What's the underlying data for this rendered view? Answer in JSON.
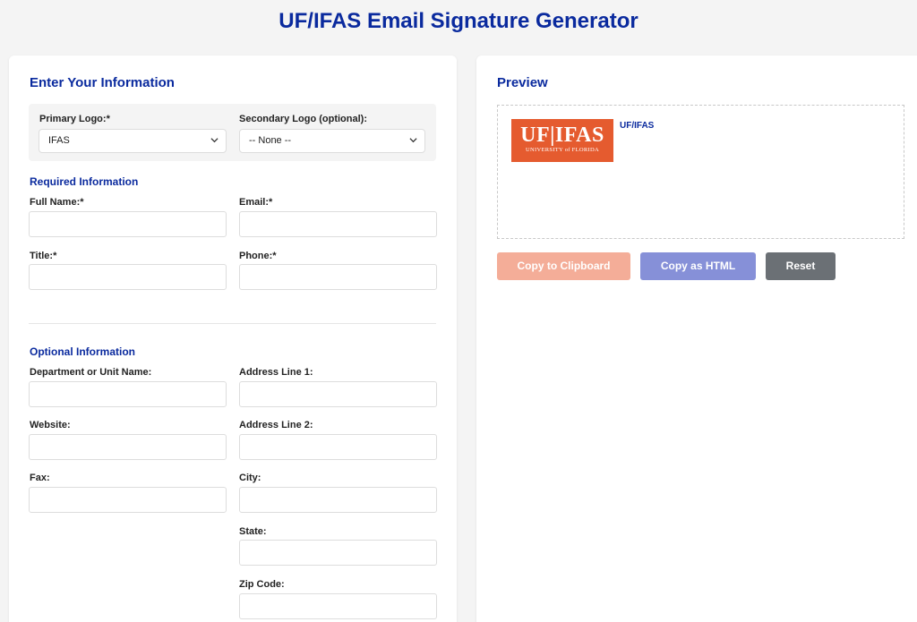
{
  "page": {
    "title": "UF/IFAS Email Signature Generator"
  },
  "form": {
    "heading": "Enter Your Information",
    "primary_logo": {
      "label": "Primary Logo:*",
      "value": "IFAS"
    },
    "secondary_logo": {
      "label": "Secondary Logo (optional):",
      "value": "-- None --"
    },
    "required_heading": "Required Information",
    "required_fields": {
      "full_name": "Full Name:*",
      "email": "Email:*",
      "title": "Title:*",
      "phone": "Phone:*"
    },
    "optional_heading": "Optional Information",
    "optional_fields": {
      "department": "Department or Unit Name:",
      "address1": "Address Line 1:",
      "website": "Website:",
      "address2": "Address Line 2:",
      "fax": "Fax:",
      "city": "City:",
      "state": "State:",
      "zip": "Zip Code:"
    }
  },
  "preview": {
    "heading": "Preview",
    "logo_main": "UF|IFAS",
    "logo_sub": "UNIVERSITY of FLORIDA",
    "org_text": "UF/IFAS",
    "buttons": {
      "copy_clipboard": "Copy to Clipboard",
      "copy_html": "Copy as HTML",
      "reset": "Reset"
    }
  },
  "colors": {
    "accent": "#0a2a9e",
    "logo_bg": "#e55b2f",
    "copy_clipboard_bg": "#f4ad98",
    "copy_html_bg": "#8690d8",
    "reset_bg": "#6b7075"
  }
}
